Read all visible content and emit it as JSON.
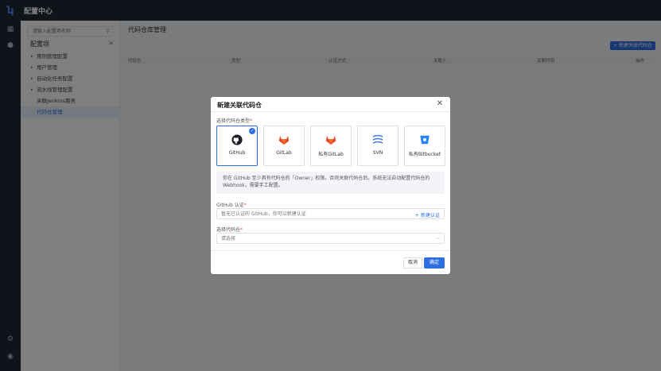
{
  "app": {
    "logo_glyph": "ʮ",
    "title": "配置中心"
  },
  "sidebar": {
    "search_placeholder": "请输入配置项名称",
    "section_title": "配置项",
    "items": [
      {
        "label": "用例管理配置",
        "caret": true
      },
      {
        "label": "用户管理",
        "caret": true
      },
      {
        "label": "自动化任务配置",
        "caret": true
      },
      {
        "label": "流水线管理配置",
        "caret": true
      },
      {
        "label": "关联Jenkins服务",
        "caret": false
      },
      {
        "label": "代码仓管理",
        "caret": false,
        "active": true
      }
    ]
  },
  "main": {
    "page_title": "代码仓库管理",
    "new_button": "+ 新建关联代码仓",
    "columns": [
      "代码仓",
      "类型",
      "认证方式",
      "关联人",
      "关联时间",
      "操作"
    ]
  },
  "modal": {
    "title": "新建关联代码仓",
    "close": "✕",
    "type_label": "选择代码仓类型",
    "types": [
      {
        "name": "GitHub",
        "icon": "github-icon",
        "selected": true
      },
      {
        "name": "GitLab",
        "icon": "gitlab-icon",
        "selected": false
      },
      {
        "name": "私有GitLab",
        "icon": "gitlab-icon",
        "selected": false
      },
      {
        "name": "SVN",
        "icon": "svn-icon",
        "selected": false
      },
      {
        "name": "私有Bitbucket",
        "icon": "bitbucket-icon",
        "selected": false
      }
    ],
    "tip": "你在 GitHub 至少具有代码仓的「Owner」权限。否则关联代码仓后，系统无法自动配置代码仓的 Webhook，需要手工配置。",
    "auth_label": "GitHub 认证",
    "auth_placeholder": "暂无已认证的 GitHub，你可以新建认证",
    "auth_link": "+ 新建认证",
    "repo_label": "选择代码仓",
    "repo_placeholder": "请选择",
    "cancel": "取消",
    "ok": "确定"
  },
  "colors": {
    "primary": "#2f6fe4",
    "gitlab": "#e24329",
    "sidebar_dark": "#1f2735"
  }
}
